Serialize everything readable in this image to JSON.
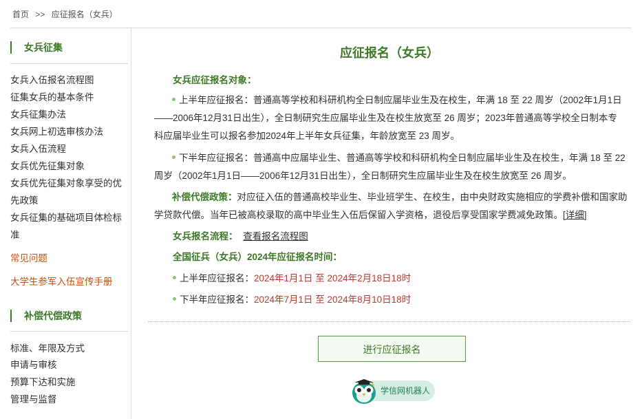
{
  "breadcrumb": {
    "home": "首页",
    "sep": ">>",
    "current": "应征报名（女兵）"
  },
  "sidebar": {
    "section1_title": "女兵征集",
    "section1_items": [
      "女兵入伍报名流程图",
      "征集女兵的基本条件",
      "女兵征集办法",
      "女兵网上初选审核办法",
      "女兵入伍流程",
      "女兵优先征集对象",
      "女兵优先征集对象享受的优",
      "先政策",
      "女兵征集的基础项目体检标",
      "准"
    ],
    "faq": "常见问题",
    "handbook": "大学生参军入伍宣传手册",
    "section2_title": "补偿代偿政策",
    "section2_items": [
      "标准、年限及方式",
      "申请与审核",
      "预算下达和实施",
      "管理与监督"
    ]
  },
  "main": {
    "title": "应征报名（女兵）",
    "target_heading": "女兵应征报名对象：",
    "first_half_line1": "上半年应征报名：普通高等学校和科研机构全日制应届毕业生及在校生，年满 18 至 22 周岁（2002年1月1日",
    "first_half_line2": "——2006年12月31日出生），全日制研究生应届毕业生及在校生放宽至 26 周岁；2023年普通高等学校全日制本专",
    "first_half_line3": "科应届毕业生可以报名参加2024年上半年女兵征集，年龄放宽至 23 周岁。",
    "second_half_line1": "下半年应征报名：普通高中应届毕业生、普通高等学校和科研机构全日制应届毕业生及在校生，年满 18 至 22",
    "second_half_line2": "周岁（2002年1月1日——2006年12月31日出生），全日制研究生应届毕业生及在校生放宽至 26 周岁。",
    "comp_label": "补偿代偿政策：",
    "comp_line1": "对应征入伍的普通高校毕业生、毕业班学生、在校生，由中央财政实施相应的学费补偿和国家助",
    "comp_line2": "学贷款代偿。当年已被高校录取的高中毕业生入伍后保留入学资格，退役后享受国家学费减免政策。",
    "comp_detail": "[详细]",
    "process_label": "女兵报名流程：",
    "process_link": "查看报名流程图",
    "time_heading": "全国征兵（女兵）2024年应征报名时间：",
    "first_time_label": "上半年应征报名：",
    "first_time_value": "2024年1月1日 至 2024年2月18日18时",
    "second_time_label": "下半年应征报名：",
    "second_time_value": "2024年7月1日 至 2024年8月10日18时",
    "apply_button": "进行应征报名",
    "robot_label": "学信网机器人"
  },
  "colors": {
    "accent_green": "#3d7a27",
    "link_orange": "#c8500a",
    "date_red": "#c0392b"
  }
}
